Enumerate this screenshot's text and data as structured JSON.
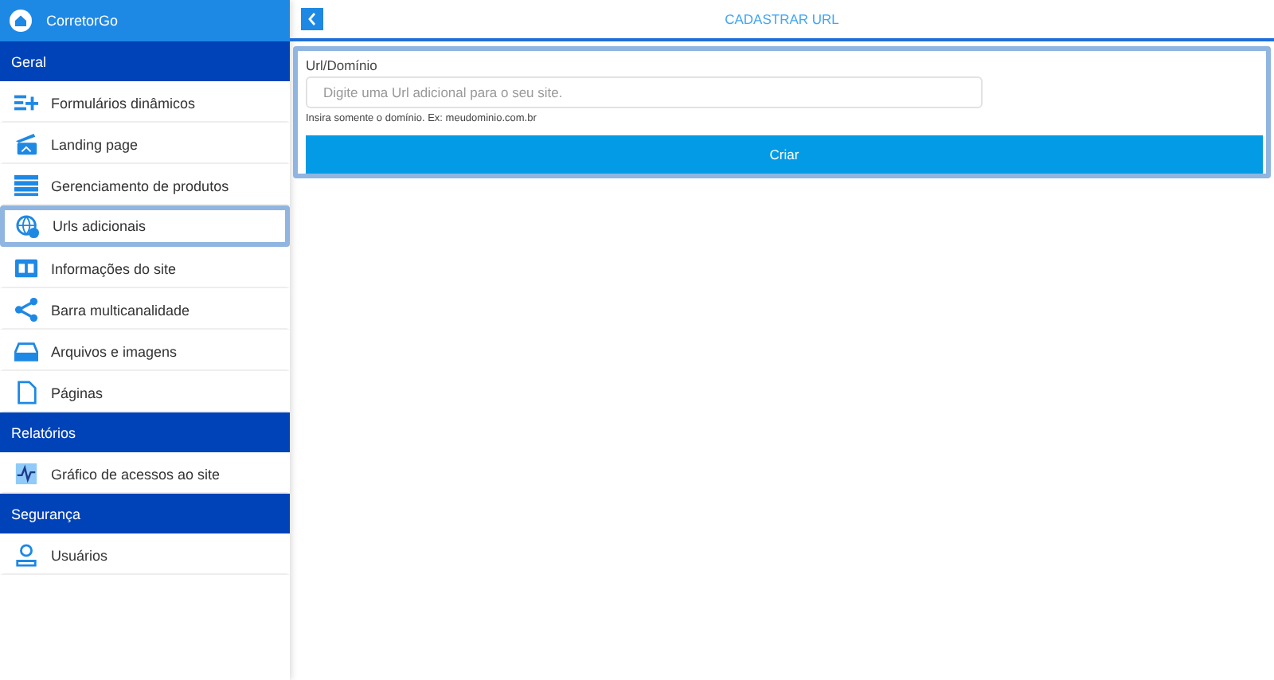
{
  "sidebar": {
    "brand": "CorretorGo",
    "sections": [
      {
        "title": "Geral",
        "items": [
          {
            "label": "Formulários dinâmicos",
            "selected": false
          },
          {
            "label": "Landing page",
            "selected": false
          },
          {
            "label": "Gerenciamento de produtos",
            "selected": false
          },
          {
            "label": "Urls adicionais",
            "selected": true
          },
          {
            "label": "Informações do site",
            "selected": false
          },
          {
            "label": "Barra multicanalidade",
            "selected": false
          },
          {
            "label": "Arquivos e imagens",
            "selected": false
          },
          {
            "label": "Páginas",
            "selected": false
          }
        ]
      },
      {
        "title": "Relatórios",
        "items": [
          {
            "label": "Gráfico de acessos ao site",
            "selected": false
          }
        ]
      },
      {
        "title": "Segurança",
        "items": [
          {
            "label": "Usuários",
            "selected": false
          }
        ]
      }
    ]
  },
  "header": {
    "title": "CADASTRAR URL"
  },
  "form": {
    "label": "Url/Domínio",
    "placeholder": "Digite uma Url adicional para o seu site.",
    "hint": "Insira somente o domínio. Ex: meudominio.com.br",
    "button": "Criar"
  }
}
